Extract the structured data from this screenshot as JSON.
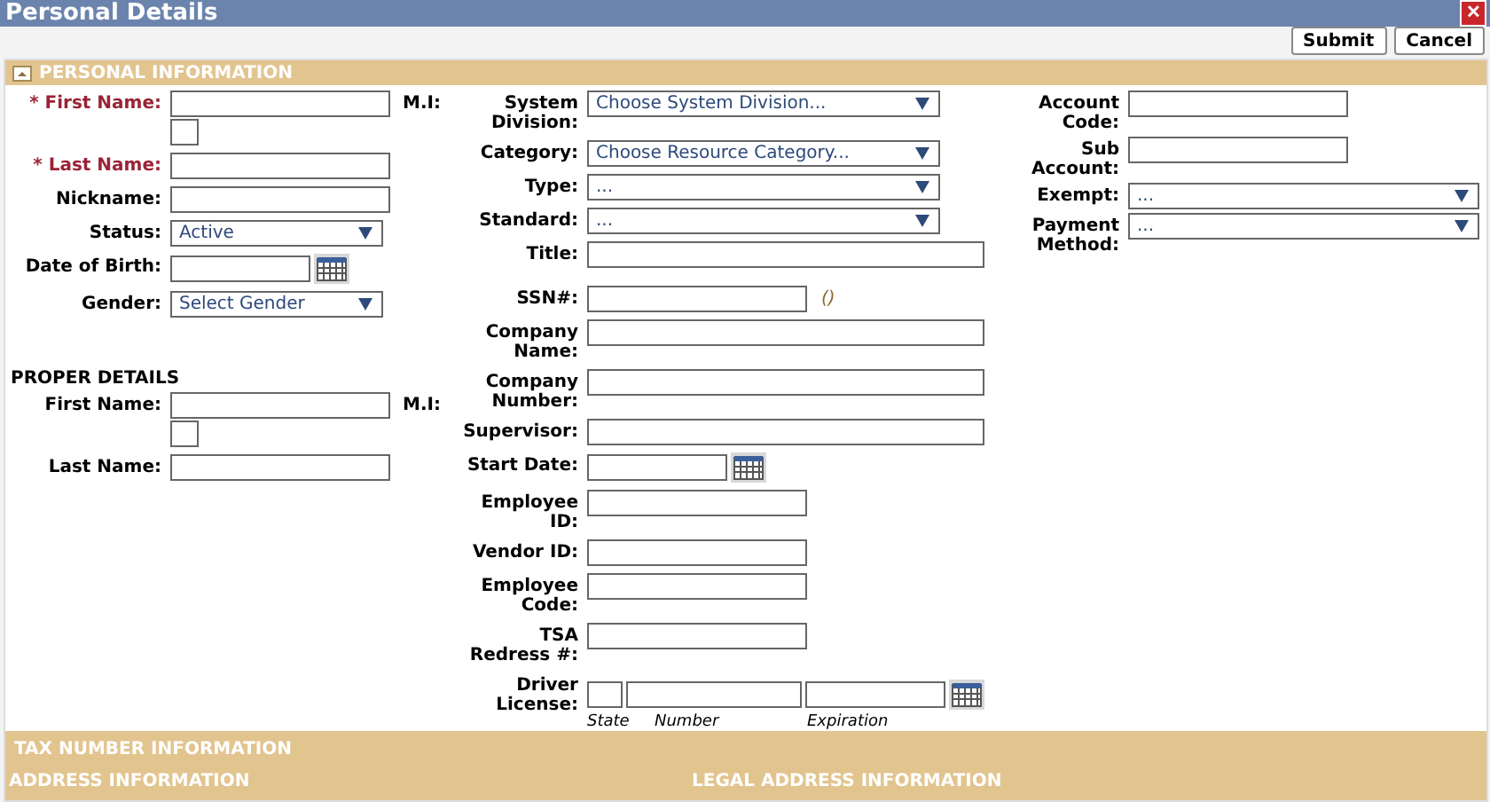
{
  "window": {
    "title": "Personal Details",
    "close": "✕"
  },
  "toolbar": {
    "buttons": [
      "Submit",
      "Cancel"
    ]
  },
  "section": {
    "title": "PERSONAL INFORMATION",
    "expanded": true
  },
  "columns": [
    {
      "groups": [
        {
          "fields": [
            {
              "kind": "name_mi",
              "label": "* First Name:",
              "required": true,
              "mi_label": "M.I:"
            },
            {
              "kind": "text",
              "label": "* Last Name:",
              "required": true
            },
            {
              "kind": "text",
              "label": "Nickname:",
              "required": false
            },
            {
              "kind": "select",
              "label": "Status:",
              "required": false,
              "value": "Active"
            },
            {
              "kind": "date",
              "label": "Date of Birth:",
              "required": false
            },
            {
              "kind": "select",
              "label": "Gender:",
              "required": false,
              "value": "Select Gender"
            }
          ]
        },
        {
          "title": "PROPER DETAILS",
          "fields": [
            {
              "kind": "name_mi",
              "label": "First Name:",
              "required": false,
              "mi_label": "M.I:"
            },
            {
              "kind": "text",
              "label": "Last Name:",
              "required": false
            }
          ]
        }
      ]
    },
    {
      "groups": [
        {
          "fields": [
            {
              "kind": "select",
              "label": "System Division:",
              "required": false,
              "value": "Choose System Division..."
            },
            {
              "kind": "select",
              "label": "Category:",
              "required": false,
              "value": "Choose Resource Category..."
            },
            {
              "kind": "select",
              "label": "Type:",
              "required": false,
              "value": "..."
            },
            {
              "kind": "select",
              "label": "Standard:",
              "required": false,
              "value": "..."
            },
            {
              "kind": "long_text",
              "label": "Title:",
              "required": false
            },
            {
              "kind": "ssn",
              "label": "SSN#:",
              "required": false,
              "hint": "()"
            },
            {
              "kind": "long_text",
              "label": "Company Name:",
              "required": false
            },
            {
              "kind": "long_text",
              "label": "Company Number:",
              "required": false
            },
            {
              "kind": "long_text",
              "label": "Supervisor:",
              "required": false
            },
            {
              "kind": "date",
              "label": "Start Date:",
              "required": false
            },
            {
              "kind": "text",
              "label": "Employee ID:",
              "required": false
            },
            {
              "kind": "text",
              "label": "Vendor ID:",
              "required": false
            },
            {
              "kind": "text",
              "label": "Employee Code:",
              "required": false
            },
            {
              "kind": "text",
              "label": "TSA Redress #:",
              "required": false
            },
            {
              "kind": "license",
              "label": "Driver License:",
              "required": false,
              "sublabels": [
                "State",
                "Number",
                "Expiration"
              ]
            }
          ]
        }
      ]
    },
    {
      "groups": [
        {
          "fields": [
            {
              "kind": "text",
              "label": "Account Code:",
              "required": false
            },
            {
              "kind": "text",
              "label": "Sub Account:",
              "required": false
            },
            {
              "kind": "select",
              "label": "Exempt:",
              "required": false,
              "value": "..."
            },
            {
              "kind": "select",
              "label": "Payment Method:",
              "required": false,
              "value": "..."
            }
          ]
        }
      ]
    }
  ],
  "footer": {
    "tax": "TAX NUMBER INFORMATION",
    "address": "ADDRESS INFORMATION",
    "legal": "LEGAL ADDRESS INFORMATION"
  }
}
